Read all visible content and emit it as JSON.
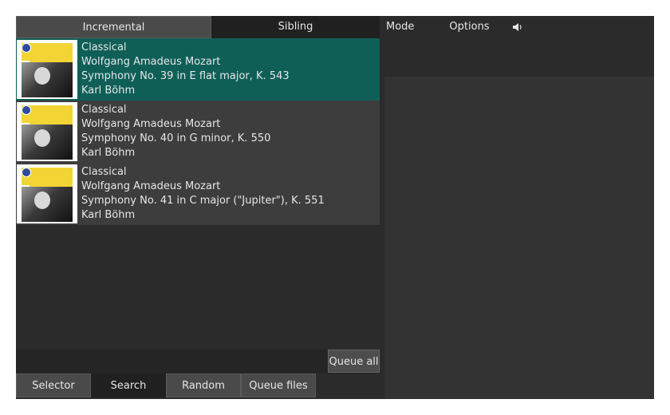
{
  "top_tabs": [
    {
      "label": "Incremental"
    },
    {
      "label": "Sibling"
    }
  ],
  "menu": {
    "mode_label": "Mode",
    "options_label": "Options",
    "volume_icon": "speaker-icon"
  },
  "tracks": [
    {
      "genre": "Classical",
      "composer": "Wolfgang Amadeus Mozart",
      "title": "Symphony No. 39 in E flat major, K. 543",
      "artist": "Karl Böhm",
      "selected": true
    },
    {
      "genre": "Classical",
      "composer": "Wolfgang Amadeus Mozart",
      "title": "Symphony No. 40 in G minor, K. 550",
      "artist": "Karl Böhm",
      "selected": false
    },
    {
      "genre": "Classical",
      "composer": "Wolfgang Amadeus Mozart",
      "title": "Symphony No. 41 in C major (\"Jupiter\"), K. 551",
      "artist": "Karl Böhm",
      "selected": false
    }
  ],
  "queue_all_label": "Queue all",
  "bottom_tabs": [
    {
      "label": "Selector"
    },
    {
      "label": "Search"
    },
    {
      "label": "Random"
    },
    {
      "label": "Queue files"
    }
  ],
  "colors": {
    "selected_row": "#0f5f57",
    "row": "#3d3d3d",
    "background": "#2b2b2b"
  }
}
